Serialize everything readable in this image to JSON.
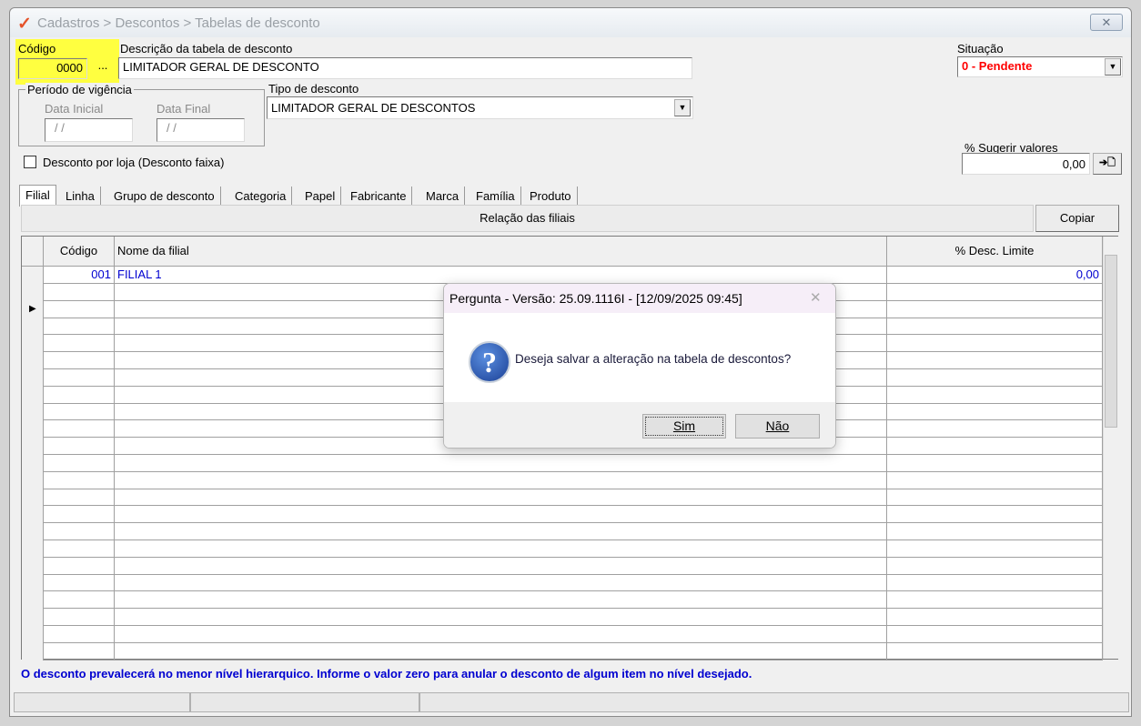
{
  "window": {
    "breadcrumb": "Cadastros > Descontos > Tabelas de desconto",
    "close": "✕",
    "logo": "✓"
  },
  "form": {
    "codigo_label": "Código",
    "codigo_value": "0000",
    "lookup_label": "...",
    "descricao_label": "Descrição da tabela de desconto",
    "descricao_value": "LIMITADOR GERAL DE DESCONTO",
    "situacao_label": "Situação",
    "situacao_value": "0 - Pendente",
    "periodo_label": "Período de vigência",
    "data_inicial_label": "Data Inicial",
    "data_inicial_value": "/ /",
    "data_final_label": "Data Final",
    "data_final_value": "/ /",
    "tipo_label": "Tipo de desconto",
    "tipo_value": "LIMITADOR GERAL DE DESCONTOS",
    "sugerir_label": "% Sugerir valores",
    "sugerir_value": "0,00",
    "apply_icon": "➔🗋",
    "desconto_loja_label": "Desconto por loja (Desconto faixa)",
    "desconto_loja_checked": false
  },
  "tabs": [
    "Filial",
    "Linha",
    "Grupo de desconto",
    "Categoria",
    "Papel",
    "Fabricante",
    "Marca",
    "Família",
    "Produto"
  ],
  "panel": {
    "title": "Relação das filiais",
    "copy": "Copiar"
  },
  "grid": {
    "headers": [
      "Código",
      "Nome da filial",
      "% Desc. Limite"
    ],
    "rows": [
      {
        "codigo": "001",
        "nome": "FILIAL 1",
        "desc": "0,00"
      }
    ],
    "current_row": 3
  },
  "footer_note": "O desconto prevalecerá no menor nível hierarquico. Informe o valor zero para anular o desconto de algum item no nível desejado.",
  "dialog": {
    "title": "Pergunta - Versão: 25.09.1116I - [12/09/2025 09:45]",
    "message": "Deseja salvar a alteração na tabela de descontos?",
    "yes": "Sim",
    "no": "Não",
    "close": "✕"
  },
  "colors": {
    "accent_red": "#ff0000",
    "link_blue": "#0000d0",
    "highlight": "#ffff40"
  }
}
